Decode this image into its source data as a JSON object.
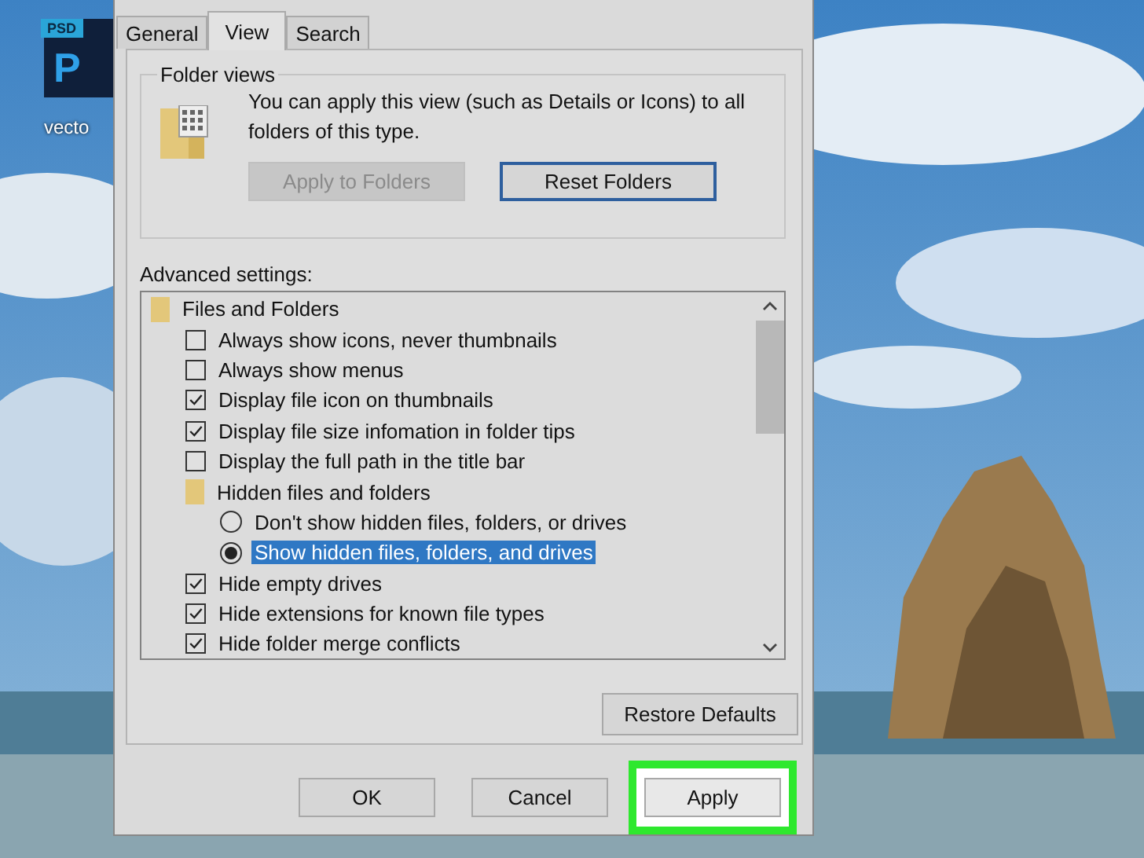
{
  "desktop_icon": {
    "badge": "PSD",
    "letter": "P",
    "label": "vecto"
  },
  "dialog": {
    "tabs": [
      {
        "label": "General",
        "selected": false
      },
      {
        "label": "View",
        "selected": true
      },
      {
        "label": "Search",
        "selected": false
      }
    ],
    "folder_views": {
      "title": "Folder views",
      "text": "You can apply this view (such as Details or Icons) to all folders of this type.",
      "buttons": [
        {
          "label": "Apply to Folders",
          "disabled": true,
          "focused": false
        },
        {
          "label": "Reset Folders",
          "disabled": false,
          "focused": true
        }
      ]
    },
    "advanced": {
      "label": "Advanced settings:",
      "items": [
        {
          "kind": "folder",
          "label": "Files and Folders",
          "children": [
            {
              "kind": "checkbox",
              "label": "Always show icons, never thumbnails",
              "checked": false
            },
            {
              "kind": "checkbox",
              "label": "Always show menus",
              "checked": false
            },
            {
              "kind": "checkbox",
              "label": "Display file icon on thumbnails",
              "checked": true
            },
            {
              "kind": "checkbox",
              "label": "Display file size infomation in folder tips",
              "checked": true
            },
            {
              "kind": "checkbox",
              "label": "Display the full path in the title bar",
              "checked": false
            },
            {
              "kind": "folder",
              "label": "Hidden files and folders",
              "children": [
                {
                  "kind": "radio",
                  "label": "Don't show hidden files, folders, or drives",
                  "selected": false
                },
                {
                  "kind": "radio",
                  "label": "Show hidden files, folders, and drives",
                  "selected": true
                }
              ]
            },
            {
              "kind": "checkbox",
              "label": "Hide empty drives",
              "checked": true
            },
            {
              "kind": "checkbox",
              "label": "Hide extensions for known file types",
              "checked": true
            },
            {
              "kind": "checkbox",
              "label": "Hide folder merge conflicts",
              "checked": true
            }
          ]
        }
      ]
    },
    "restore_button": "Restore Defaults",
    "buttons": [
      {
        "label": "OK",
        "highlighted": false
      },
      {
        "label": "Cancel",
        "highlighted": false
      },
      {
        "label": "Apply",
        "highlighted": true
      }
    ]
  }
}
